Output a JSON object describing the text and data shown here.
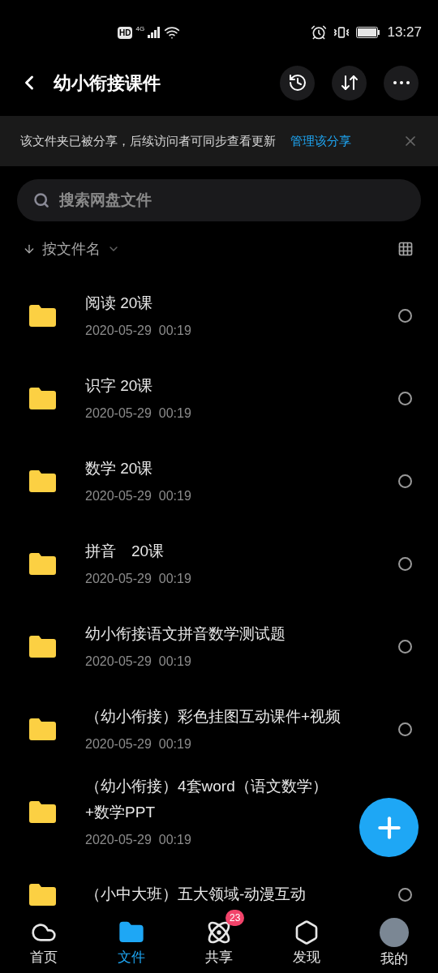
{
  "status_bar": {
    "time": "13:27",
    "network": "4G",
    "hd": "HD"
  },
  "header": {
    "title": "幼小衔接课件"
  },
  "share_banner": {
    "message": "该文件夹已被分享，后续访问者可同步查看更新",
    "link": "管理该分享"
  },
  "search": {
    "placeholder": "搜索网盘文件"
  },
  "sort": {
    "label": "按文件名"
  },
  "files": [
    {
      "name": "阅读 20课",
      "date": "2020-05-29  00:19",
      "selected": false
    },
    {
      "name": "识字 20课",
      "date": "2020-05-29  00:19",
      "selected": false
    },
    {
      "name": "数学 20课",
      "date": "2020-05-29  00:19",
      "selected": false
    },
    {
      "name": "拼音　20课",
      "date": "2020-05-29  00:19",
      "selected": false
    },
    {
      "name": "幼小衔接语文拼音数学测试题",
      "date": "2020-05-29  00:19",
      "selected": false
    },
    {
      "name": "（幼小衔接）彩色挂图互动课件+视频",
      "date": "2020-05-29  00:19",
      "selected": false
    },
    {
      "name": "（幼小衔接）4套word（语文数学）+数学PPT",
      "date": "2020-05-29  00:19"
    },
    {
      "name": "（小中大班）五大领域-动漫互动",
      "selected": false
    }
  ],
  "nav": [
    {
      "label": "首页",
      "kind": "home",
      "selected": false
    },
    {
      "label": "文件",
      "kind": "files",
      "selected": true
    },
    {
      "label": "共享",
      "kind": "share",
      "selected": false,
      "badge": "23"
    },
    {
      "label": "发现",
      "kind": "discover",
      "selected": false
    },
    {
      "label": "我的",
      "kind": "me",
      "selected": false
    }
  ]
}
